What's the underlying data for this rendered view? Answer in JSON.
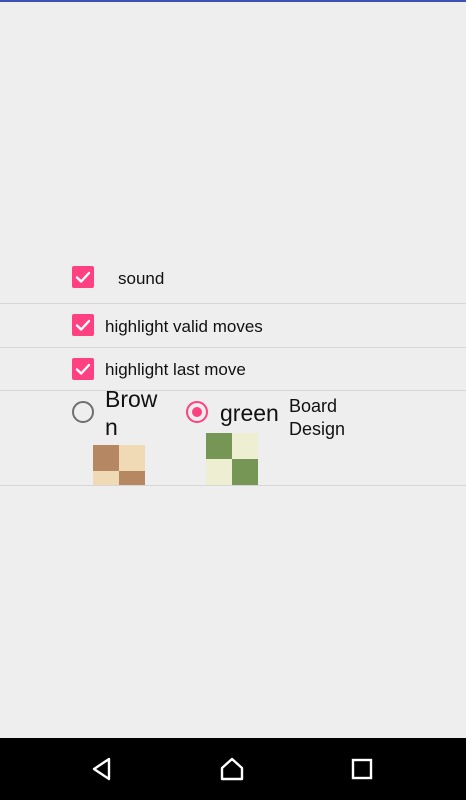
{
  "colors": {
    "accent": "#ff4081",
    "radio_unselected": "#6f6f6f",
    "background": "#eeeeee",
    "navbar": "#000000"
  },
  "settings": {
    "sound_label": "sound",
    "sound_checked": true,
    "highlight_valid_label": "highlight valid moves",
    "highlight_valid_checked": true,
    "highlight_last_label": "highlight last move",
    "highlight_last_checked": true
  },
  "board_design": {
    "label_line1": "Board",
    "label_line2": "Design",
    "options": [
      {
        "label_line1": "Brow",
        "label_line2": "n",
        "selected": false,
        "colors": [
          "#b58863",
          "#f0d9b5",
          "#f0d9b5",
          "#b58863"
        ]
      },
      {
        "label": "green",
        "selected": true,
        "colors": [
          "#769656",
          "#eeeed2",
          "#eeeed2",
          "#769656"
        ]
      }
    ]
  },
  "navbar": {
    "icons": [
      "back-icon",
      "home-icon",
      "recents-icon"
    ]
  }
}
